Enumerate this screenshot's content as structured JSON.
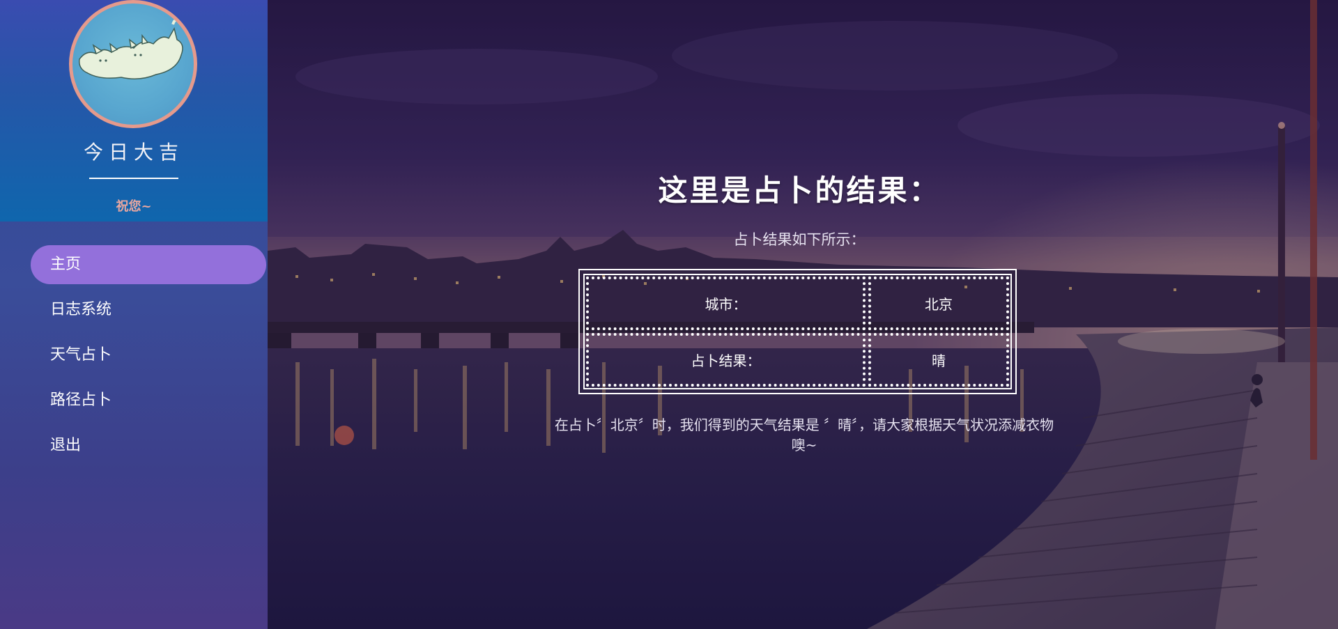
{
  "sidebar": {
    "brand_title": "今日大吉",
    "brand_subtitle": "祝您~",
    "nav_items": [
      {
        "label": "主页",
        "active": true
      },
      {
        "label": "日志系统",
        "active": false
      },
      {
        "label": "天气占卜",
        "active": false
      },
      {
        "label": "路径占卜",
        "active": false
      },
      {
        "label": "退出",
        "active": false
      }
    ]
  },
  "main": {
    "title": "这里是占卜的结果：",
    "subtitle": "占卜结果如下所示：",
    "table": {
      "rows": [
        {
          "label": "城市：",
          "value": "北京"
        },
        {
          "label": "占卜结果：",
          "value": "晴"
        }
      ]
    },
    "note": "在占卜〞北京〞时，我们得到的天气结果是 〞晴〞，请大家根据天气状况添减衣物噢~"
  },
  "colors": {
    "active_nav": "#9370db",
    "sidebar_header": "#0f66ad",
    "avatar_border": "#e59a8c",
    "subtitle_pink": "#e9a7a0"
  },
  "icons": {
    "avatar": "cats-avatar-icon"
  }
}
